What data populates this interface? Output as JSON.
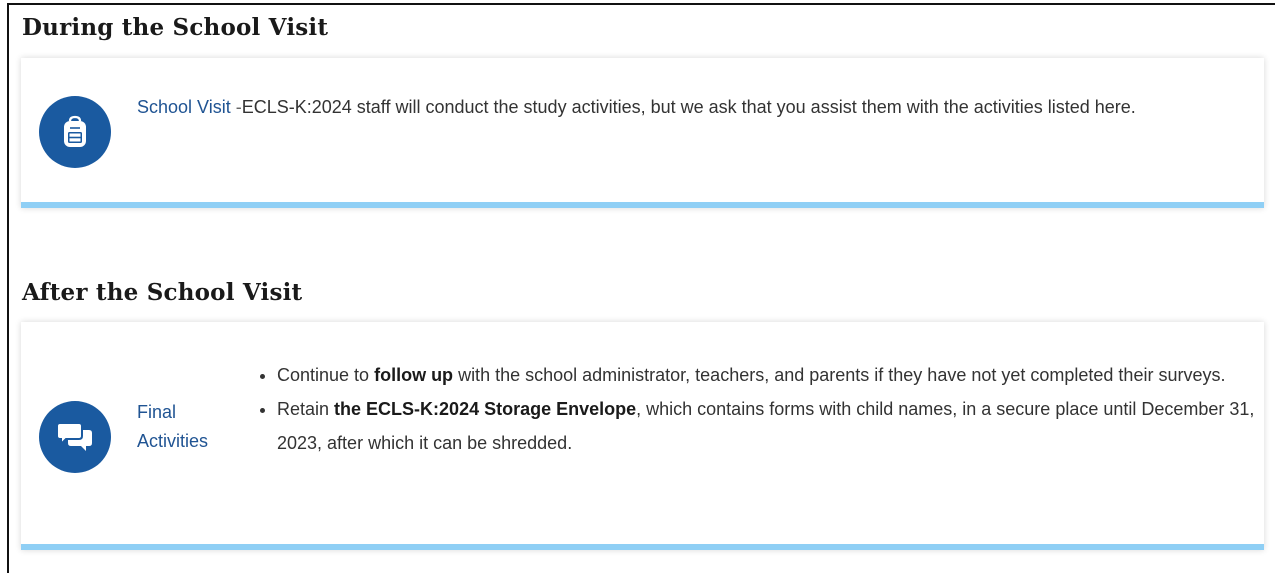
{
  "during": {
    "heading": "During the School Visit",
    "link": "School Visit",
    "separator": " -",
    "text": "ECLS-K:2024 staff will conduct the study activities, but we ask that you assist them with the activities listed here."
  },
  "after": {
    "heading": "After the School Visit",
    "link": "Final Activities",
    "bullets": [
      {
        "pre": "Continue to ",
        "bold": "follow up",
        "post": " with the school administrator, teachers, and parents if they have not yet completed their surveys."
      },
      {
        "pre": "Retain ",
        "bold": "the ECLS-K:2024 Storage Envelope",
        "post": ", which contains forms with child names, in a secure place until December 31, 2023, after which it can be shredded."
      }
    ]
  },
  "icons": {
    "during": "backpack-icon",
    "after": "chat-bubbles-icon",
    "circle_color": "#1a5aa0",
    "accent_bar_color": "#8fcff5",
    "link_color": "#205493"
  }
}
